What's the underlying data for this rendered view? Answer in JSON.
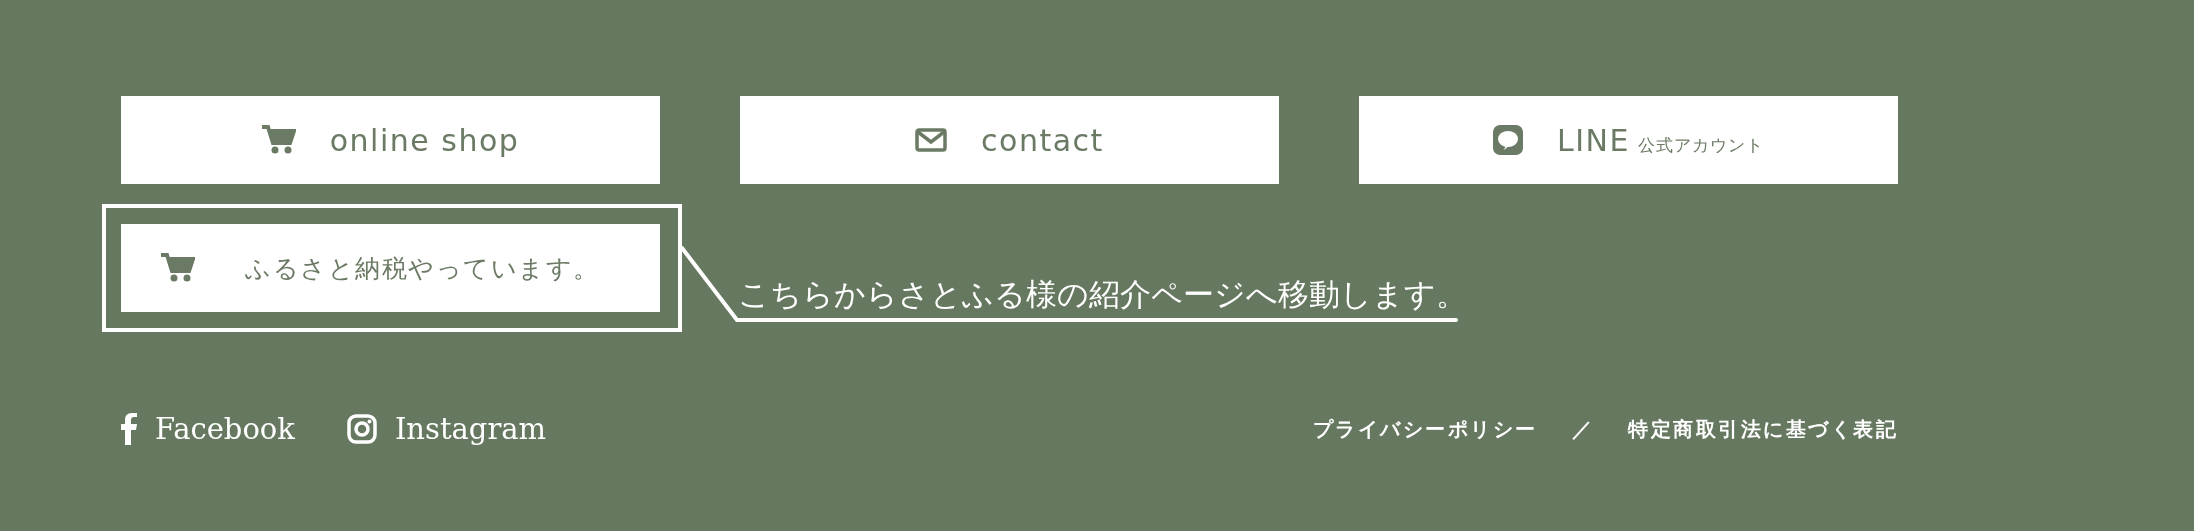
{
  "buttons": [
    {
      "kind": "cart",
      "label": "online shop"
    },
    {
      "kind": "mail",
      "label": "contact"
    },
    {
      "kind": "line",
      "label": "LINE",
      "sublabel": "公式アカウント"
    }
  ],
  "furusato": {
    "kind": "cart",
    "label": "ふるさと納税やっています。",
    "callout": "こちらからさとふる様の紹介ページへ移動します。"
  },
  "social": [
    {
      "kind": "facebook",
      "label": "Facebook"
    },
    {
      "kind": "instagram",
      "label": "Instagram"
    }
  ],
  "legal_links": [
    {
      "label": "プライバシーポリシー"
    },
    {
      "label": "特定商取引法に基づく表記"
    }
  ],
  "legal_separator": "／"
}
